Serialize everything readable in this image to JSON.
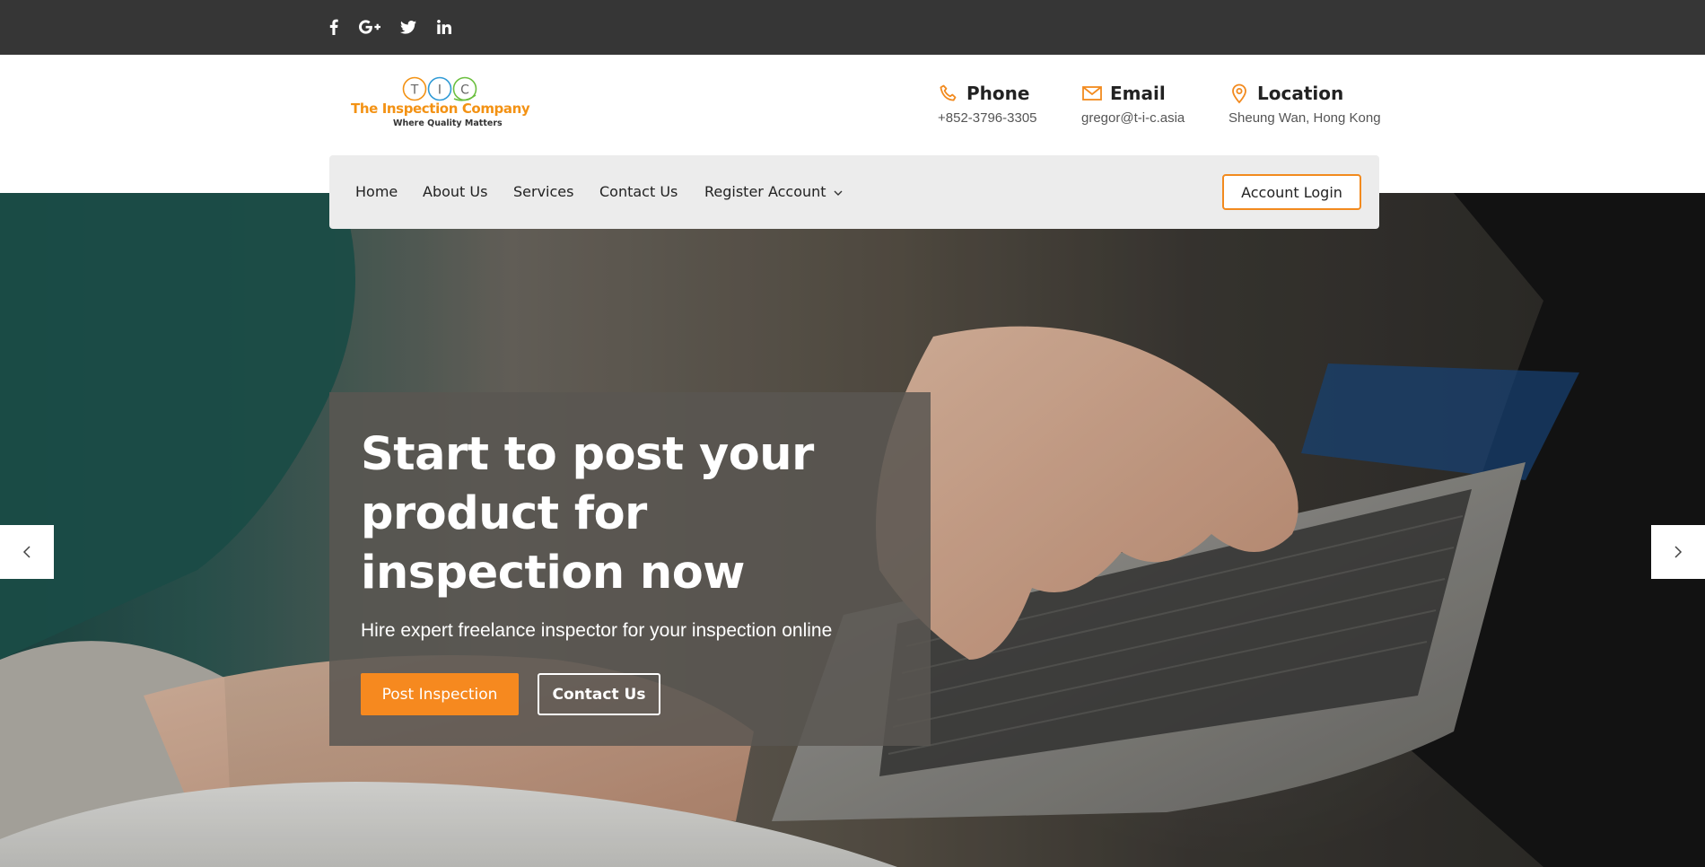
{
  "social": {
    "icons": [
      "facebook-icon",
      "google-plus-icon",
      "twitter-icon",
      "linkedin-icon"
    ]
  },
  "logo": {
    "letters": [
      "T",
      "I",
      "C"
    ],
    "name": "The Inspection Company",
    "tagline": "Where Quality Matters",
    "colors": {
      "t": "#f39214",
      "i": "#2f9ad6",
      "c": "#6bbf3f"
    }
  },
  "contacts": [
    {
      "icon": "phone-icon",
      "title": "Phone",
      "value": "+852-3796-3305"
    },
    {
      "icon": "email-icon",
      "title": "Email",
      "value": "gregor@t-i-c.asia"
    },
    {
      "icon": "location-pin-icon",
      "title": "Location",
      "value": "Sheung Wan, Hong Kong"
    }
  ],
  "nav": {
    "items": [
      "Home",
      "About Us",
      "Services",
      "Contact Us",
      "Register Account"
    ],
    "login": "Account Login"
  },
  "hero": {
    "title": "Start to post your product for inspection now",
    "subtitle": "Hire expert freelance inspector for your inspection online",
    "primary_button": "Post Inspection",
    "secondary_button": "Contact Us"
  },
  "colors": {
    "accent": "#f6891f",
    "topbar": "#363636",
    "navbar": "#ececec"
  }
}
